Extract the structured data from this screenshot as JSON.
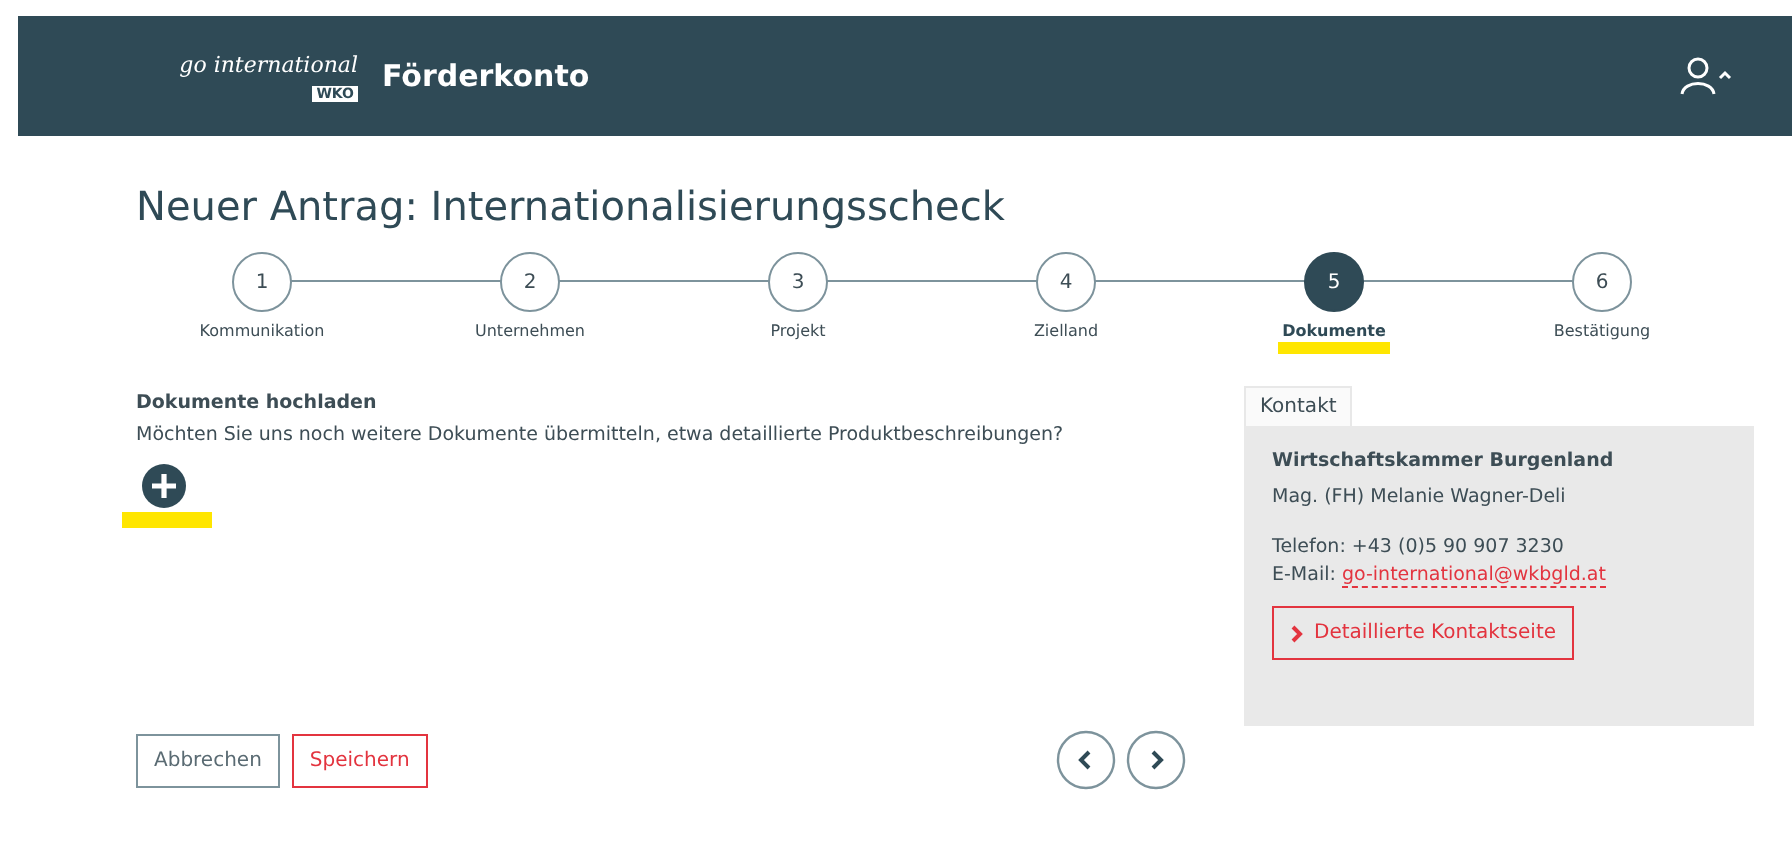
{
  "header": {
    "logo_script": "go international",
    "logo_badge": "WKO",
    "title": "Förderkonto"
  },
  "page_title": "Neuer Antrag: Internationalisierungsscheck",
  "steps": [
    {
      "number": "1",
      "label": "Kommunikation",
      "selected": false,
      "highlighted": false
    },
    {
      "number": "2",
      "label": "Unternehmen",
      "selected": false,
      "highlighted": false
    },
    {
      "number": "3",
      "label": "Projekt",
      "selected": false,
      "highlighted": false
    },
    {
      "number": "4",
      "label": "Zielland",
      "selected": false,
      "highlighted": false
    },
    {
      "number": "5",
      "label": "Dokumente",
      "selected": true,
      "highlighted": true
    },
    {
      "number": "6",
      "label": "Bestätigung",
      "selected": false,
      "highlighted": false
    }
  ],
  "upload": {
    "heading": "Dokumente hochladen",
    "question": "Möchten Sie uns noch weitere Dokumente übermitteln, etwa detaillierte Produktbeschreibungen?",
    "add_highlighted": true
  },
  "contact": {
    "tab": "Kontakt",
    "organisation": "Wirtschaftskammer Burgenland",
    "person": "Mag. (FH) Melanie Wagner-Deli",
    "phone": "Telefon: +43 (0)5 90 907 3230",
    "email_label": "E-Mail:",
    "email": "go-international@wkbgld.at",
    "button": "Detaillierte Kontaktseite"
  },
  "actions": {
    "cancel": "Abbrechen",
    "save": "Speichern"
  }
}
